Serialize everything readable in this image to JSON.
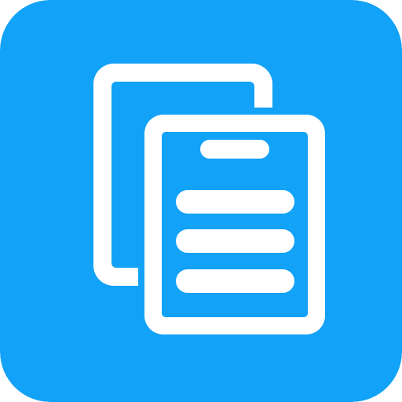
{
  "app_icon": {
    "icon": "copy-documents-icon",
    "colors": {
      "background": "#12A2F7",
      "foreground": "#FFFFFF"
    },
    "back_document": {
      "icon": "back-document-icon"
    },
    "front_document": {
      "icon": "front-document-icon",
      "lines": 4
    }
  }
}
